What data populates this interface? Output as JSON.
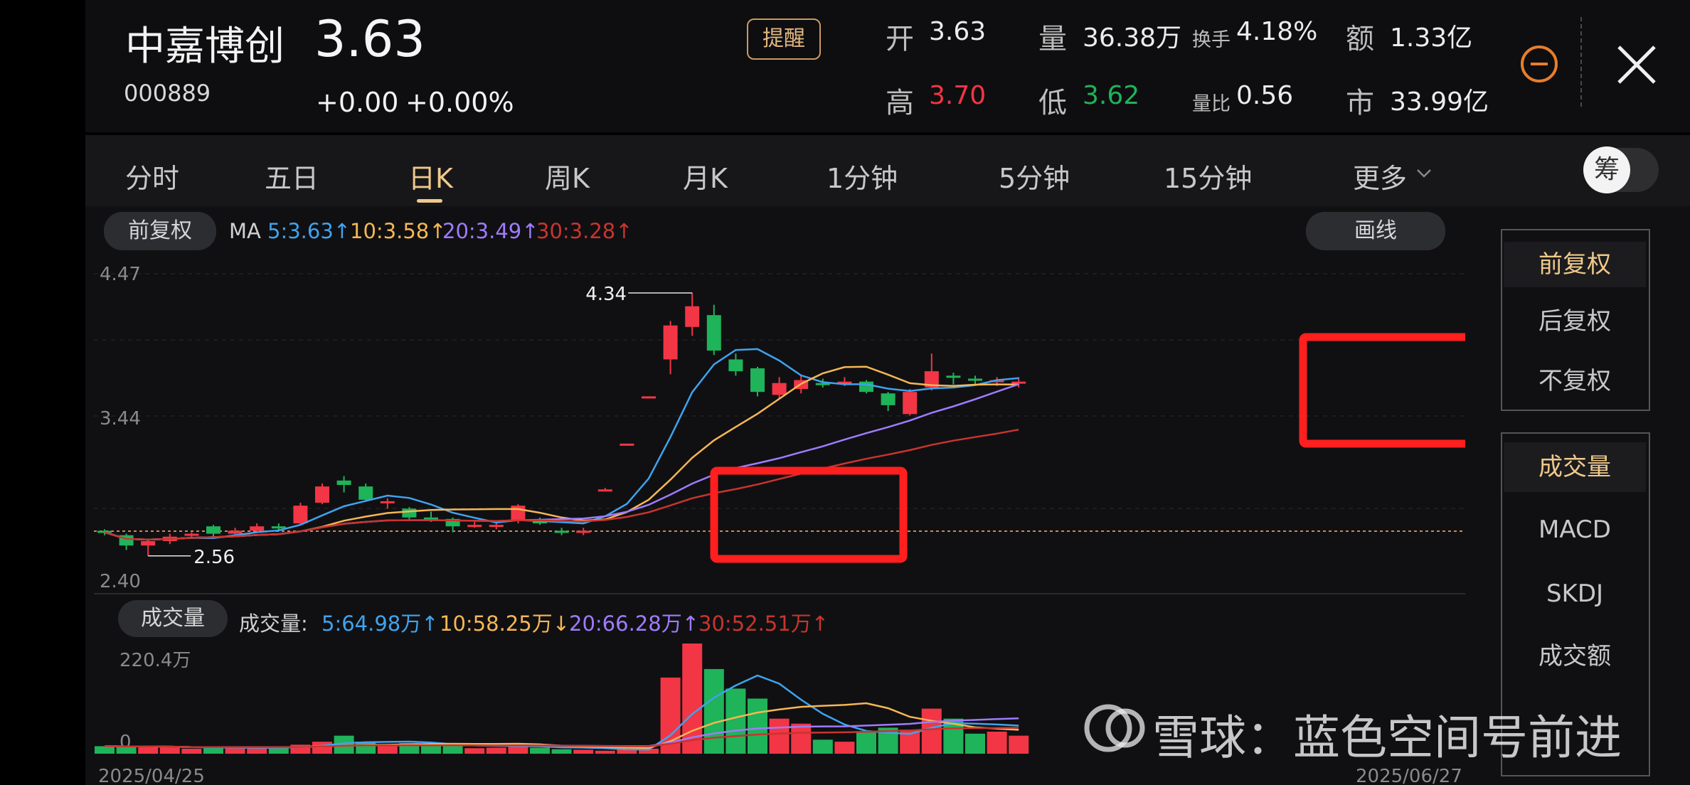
{
  "header": {
    "name": "中嘉博创",
    "code": "000889",
    "price": "3.63",
    "change": "+0.00",
    "change_pct": "+0.00%",
    "alert_label": "提醒",
    "stats": {
      "open_label": "开",
      "open": "3.63",
      "volume_label": "量",
      "volume": "36.38万",
      "turnover_label": "换手",
      "turnover": "4.18%",
      "amount_label": "额",
      "amount": "1.33亿",
      "high_label": "高",
      "high": "3.70",
      "low_label": "低",
      "low": "3.62",
      "vol_ratio_label": "量比",
      "vol_ratio": "0.56",
      "mktcap_label": "市",
      "mktcap": "33.99亿"
    }
  },
  "tabs": [
    "分时",
    "五日",
    "日K",
    "周K",
    "月K",
    "1分钟",
    "5分钟",
    "15分钟",
    "更多"
  ],
  "active_tab": "日K",
  "chip_toggle_label": "筹",
  "chart_toolbar": {
    "adjust_label": "前复权",
    "ma_label": "MA",
    "ma5": "5:3.63",
    "ma10": "10:3.58",
    "ma20": "20:3.49",
    "ma30": "30:3.28",
    "draw_label": "画线"
  },
  "volume_toolbar": {
    "label": "成交量",
    "prefix": "成交量:",
    "ma5": "5:64.98万",
    "ma10": "10:58.25万",
    "ma20": "20:66.28万",
    "ma30": "30:52.51万"
  },
  "side_menu": {
    "adjust": [
      "前复权",
      "后复权",
      "不复权"
    ],
    "indicators": [
      "成交量",
      "MACD",
      "SKDJ",
      "成交额"
    ]
  },
  "watermark": "雪球：蓝色空间号前进",
  "colors": {
    "up": "#f23645",
    "down": "#1fb35a",
    "ma5": "#3fa3ef",
    "ma10": "#f5b755",
    "ma20": "#9f7bff",
    "ma30": "#c9342e",
    "accent": "#f0c98a",
    "highlight_box": "#ff1f1f"
  },
  "chart_data": {
    "type": "candlestick",
    "y_axis_labels": [
      "4.47",
      "3.44",
      "2.40"
    ],
    "ylim": [
      2.4,
      4.47
    ],
    "max_label": "4.34",
    "min_label": "2.56",
    "x_start_label": "2025/04/25",
    "x_end_label": "2025/06/27",
    "volume_axis_labels": [
      "220.4万",
      "0"
    ],
    "candles": [
      {
        "o": 2.73,
        "c": 2.72,
        "h": 2.74,
        "l": 2.7,
        "v": 15
      },
      {
        "o": 2.7,
        "c": 2.63,
        "h": 2.71,
        "l": 2.6,
        "v": 14
      },
      {
        "o": 2.63,
        "c": 2.66,
        "h": 2.67,
        "l": 2.56,
        "v": 15
      },
      {
        "o": 2.66,
        "c": 2.69,
        "h": 2.71,
        "l": 2.64,
        "v": 12
      },
      {
        "o": 2.7,
        "c": 2.71,
        "h": 2.72,
        "l": 2.68,
        "v": 10
      },
      {
        "o": 2.76,
        "c": 2.71,
        "h": 2.77,
        "l": 2.69,
        "v": 12
      },
      {
        "o": 2.71,
        "c": 2.73,
        "h": 2.75,
        "l": 2.7,
        "v": 11
      },
      {
        "o": 2.73,
        "c": 2.76,
        "h": 2.78,
        "l": 2.72,
        "v": 14
      },
      {
        "o": 2.76,
        "c": 2.75,
        "h": 2.78,
        "l": 2.73,
        "v": 12
      },
      {
        "o": 2.78,
        "c": 2.9,
        "h": 2.92,
        "l": 2.77,
        "v": 18
      },
      {
        "o": 2.92,
        "c": 3.03,
        "h": 3.05,
        "l": 2.91,
        "v": 24
      },
      {
        "o": 3.07,
        "c": 3.04,
        "h": 3.1,
        "l": 2.99,
        "v": 36
      },
      {
        "o": 3.03,
        "c": 2.94,
        "h": 3.05,
        "l": 2.93,
        "v": 24
      },
      {
        "o": 2.92,
        "c": 2.93,
        "h": 2.95,
        "l": 2.88,
        "v": 16
      },
      {
        "o": 2.88,
        "c": 2.82,
        "h": 2.89,
        "l": 2.8,
        "v": 21
      },
      {
        "o": 2.82,
        "c": 2.81,
        "h": 2.86,
        "l": 2.79,
        "v": 15
      },
      {
        "o": 2.81,
        "c": 2.76,
        "h": 2.82,
        "l": 2.72,
        "v": 19
      },
      {
        "o": 2.76,
        "c": 2.77,
        "h": 2.79,
        "l": 2.75,
        "v": 11
      },
      {
        "o": 2.76,
        "c": 2.77,
        "h": 2.79,
        "l": 2.74,
        "v": 12
      },
      {
        "o": 2.8,
        "c": 2.9,
        "h": 2.91,
        "l": 2.78,
        "v": 20
      },
      {
        "o": 2.8,
        "c": 2.78,
        "h": 2.82,
        "l": 2.77,
        "v": 12
      },
      {
        "o": 2.73,
        "c": 2.72,
        "h": 2.75,
        "l": 2.7,
        "v": 9
      },
      {
        "o": 2.72,
        "c": 2.73,
        "h": 2.75,
        "l": 2.7,
        "v": 8
      },
      {
        "o": 3.0,
        "c": 3.01,
        "h": 3.02,
        "l": 3.0,
        "v": 6
      },
      {
        "o": 3.31,
        "c": 3.32,
        "h": 3.32,
        "l": 3.31,
        "v": 8
      },
      {
        "o": 3.63,
        "c": 3.64,
        "h": 3.64,
        "l": 3.63,
        "v": 10
      },
      {
        "o": 3.89,
        "c": 4.12,
        "h": 4.15,
        "l": 3.79,
        "v": 152
      },
      {
        "o": 4.11,
        "c": 4.25,
        "h": 4.34,
        "l": 4.05,
        "v": 220
      },
      {
        "o": 4.19,
        "c": 3.95,
        "h": 4.26,
        "l": 3.92,
        "v": 169
      },
      {
        "o": 3.89,
        "c": 3.81,
        "h": 3.93,
        "l": 3.78,
        "v": 130
      },
      {
        "o": 3.83,
        "c": 3.67,
        "h": 3.84,
        "l": 3.64,
        "v": 110
      },
      {
        "o": 3.65,
        "c": 3.73,
        "h": 3.77,
        "l": 3.62,
        "v": 70
      },
      {
        "o": 3.69,
        "c": 3.75,
        "h": 3.78,
        "l": 3.66,
        "v": 60
      },
      {
        "o": 3.73,
        "c": 3.72,
        "h": 3.76,
        "l": 3.7,
        "v": 28
      },
      {
        "o": 3.74,
        "c": 3.74,
        "h": 3.77,
        "l": 3.71,
        "v": 24
      },
      {
        "o": 3.74,
        "c": 3.67,
        "h": 3.75,
        "l": 3.66,
        "v": 45
      },
      {
        "o": 3.66,
        "c": 3.58,
        "h": 3.67,
        "l": 3.54,
        "v": 52
      },
      {
        "o": 3.52,
        "c": 3.67,
        "h": 3.69,
        "l": 3.51,
        "v": 48
      },
      {
        "o": 3.7,
        "c": 3.81,
        "h": 3.93,
        "l": 3.68,
        "v": 90
      },
      {
        "o": 3.78,
        "c": 3.77,
        "h": 3.8,
        "l": 3.72,
        "v": 70
      },
      {
        "o": 3.76,
        "c": 3.75,
        "h": 3.78,
        "l": 3.72,
        "v": 40
      },
      {
        "o": 3.74,
        "c": 3.75,
        "h": 3.77,
        "l": 3.71,
        "v": 44
      },
      {
        "o": 3.74,
        "c": 3.74,
        "h": 3.77,
        "l": 3.7,
        "v": 36
      }
    ]
  }
}
